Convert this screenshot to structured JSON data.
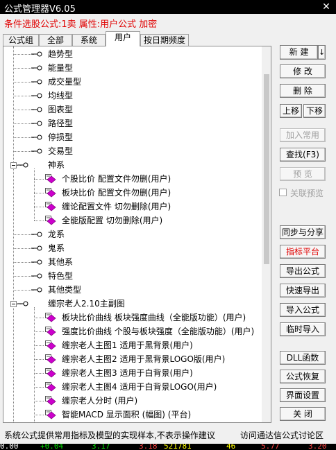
{
  "window": {
    "title": "公式管理器V6.05",
    "close_glyph": "✕"
  },
  "status": {
    "text": "条件选股公式:1卖  属性:用户公式  加密"
  },
  "tabs": [
    {
      "label": "公式组"
    },
    {
      "label": "全部"
    },
    {
      "label": "系统"
    },
    {
      "label": "用户"
    },
    {
      "label": "按日期频度"
    }
  ],
  "tree": {
    "items": [
      {
        "label": "趋势型"
      },
      {
        "label": "能量型"
      },
      {
        "label": "成交量型"
      },
      {
        "label": "均线型"
      },
      {
        "label": "图表型"
      },
      {
        "label": "路径型"
      },
      {
        "label": "停损型"
      },
      {
        "label": "交易型"
      },
      {
        "label": "神系"
      },
      {
        "label": "个股比价   配置文件勿删(用户)"
      },
      {
        "label": "板块比价   配置文件勿删(用户)"
      },
      {
        "label": "缠论配置文件   切勿删除(用户)"
      },
      {
        "label": "全能版配置   切勿删除(用户)"
      },
      {
        "label": "龙系"
      },
      {
        "label": "鬼系"
      },
      {
        "label": "其他系"
      },
      {
        "label": "特色型"
      },
      {
        "label": "其他类型"
      },
      {
        "label": "缠宗老人2.10主副图"
      },
      {
        "label": "板块比价曲线   板块强度曲线（全能版功能）(用户)"
      },
      {
        "label": "强度比价曲线   个股与板块强度（全能版功能）(用户)"
      },
      {
        "label": "缠宗老人主图1   适用于黑背景(用户)"
      },
      {
        "label": "缠宗老人主图2   适用于黑背景LOGO版(用户)"
      },
      {
        "label": "缠宗老人主图3   适用于白背景(用户)"
      },
      {
        "label": "缠宗老人主图4   适用于白背景LOGO(用户)"
      },
      {
        "label": "缠宗老人分时  (用户)"
      },
      {
        "label": "智能MACD   显示面积  (幅图)  (平台)"
      }
    ]
  },
  "buttons": {
    "new": "新  建",
    "new_arrow": "↓",
    "modify": "修  改",
    "delete": "删  除",
    "move_up": "上移",
    "move_down": "下移",
    "add_common": "加入常用",
    "find": "查找(F3)",
    "preview": "预  览",
    "linked_preview": "关联预览",
    "sync_share": "同步与分享",
    "indicator_platform": "指标平台",
    "export": "导出公式",
    "quick_export": "快速导出",
    "import": "导入公式",
    "temp_import": "临时导入",
    "dll": "DLL函数",
    "restore": "公式恢复",
    "ui_settings": "界面设置",
    "close": "关  闭"
  },
  "footer": {
    "left": "系统公式提供常用指标及模型的实现样本,不表示操作建议",
    "right": "访问通达信公式讨论区"
  },
  "ticker": {
    "values": [
      "0.00",
      "+0.04",
      "3.17",
      "3.18",
      "521781",
      "46",
      "5.77",
      "3.20"
    ]
  },
  "colors": {
    "accent_red": "#e00000",
    "formula_icon_magenta": "#cc00cc",
    "ticker_green": "#00e000",
    "ticker_yellow": "#ffff00",
    "ticker_red": "#ff4040"
  }
}
